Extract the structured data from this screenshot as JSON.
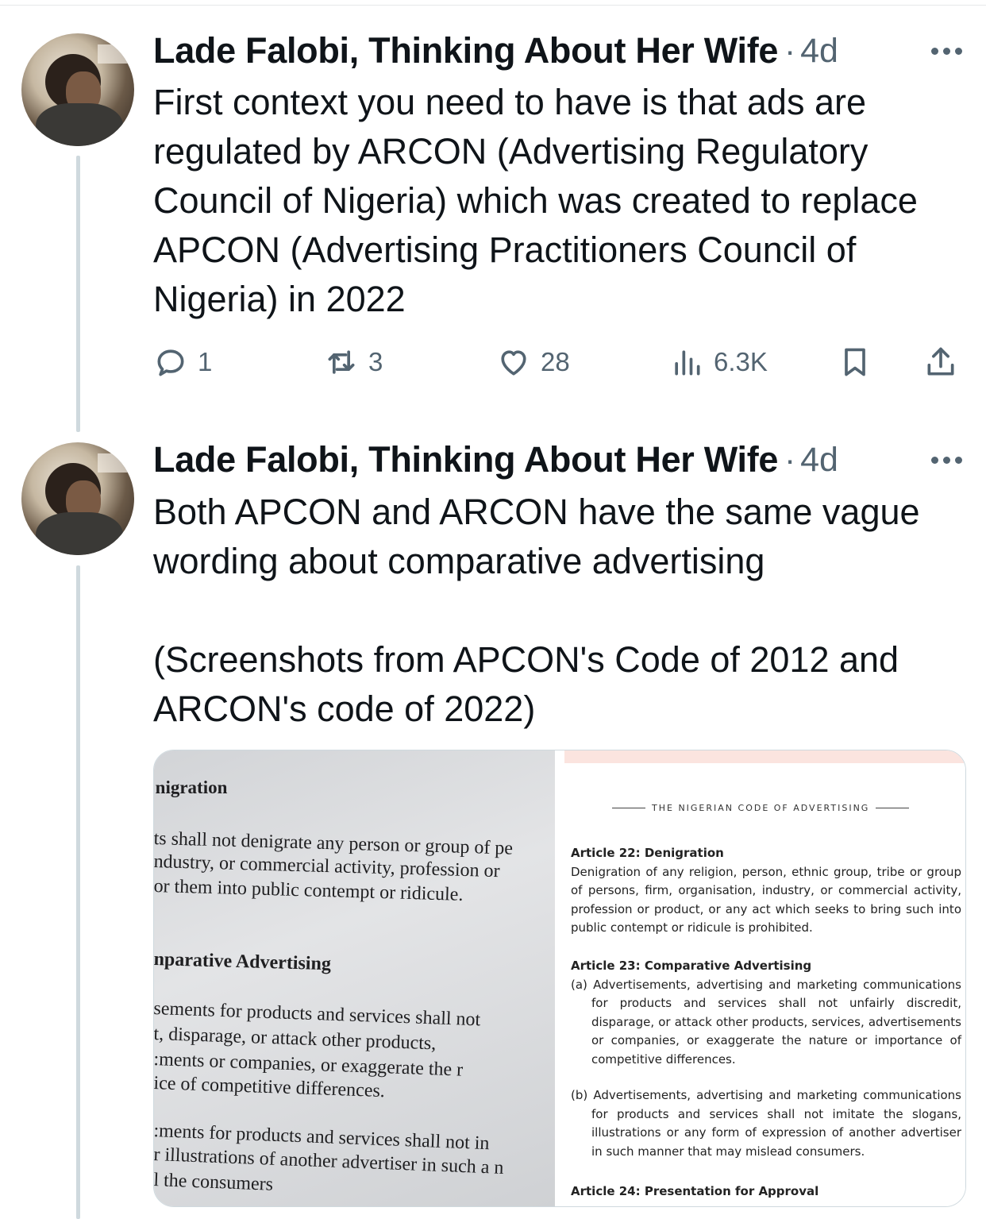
{
  "tweets": [
    {
      "author": "Lade Falobi, Thinking About Her Wife",
      "separator": "·",
      "time": "4d",
      "text": "First context you need to have is that ads are regulated by ARCON (Advertising Regulatory Council of Nigeria) which was created to replace APCON (Advertising Practitioners Council of Nigeria) in 2022",
      "replies": "1",
      "retweets": "3",
      "likes": "28",
      "views": "6.3K"
    },
    {
      "author": "Lade Falobi, Thinking About Her Wife",
      "separator": "·",
      "time": "4d",
      "text": "Both APCON and ARCON have the same vague wording about comparative advertising\n\n(Screenshots from APCON's Code of 2012 and ARCON's code of 2022)",
      "media": {
        "left_photo_lines": [
          ":nigration",
          "ts shall not denigrate any person or group of pe",
          "ndustry, or commercial activity, profession or",
          "or them into public contempt or ridicule.",
          "nparative Advertising",
          "sements for products and services shall not",
          "t, disparage, or attack other products,",
          ":ments or companies, or exaggerate the r",
          "ice of competitive differences.",
          ":ments for products and services shall not in",
          "r illustrations of another advertiser in such a n",
          "l the consumers"
        ],
        "right_doc": {
          "header": "THE NIGERIAN CODE OF ADVERTISING",
          "article22_title": "Article 22: Denigration",
          "article22_text": "Denigration of any religion, person, ethnic group, tribe or group of persons, firm, organisation, industry, or commercial activity, profession or product, or any act which seeks to bring such into public contempt or ridicule is prohibited.",
          "article23_title": "Article 23: Comparative Advertising",
          "article23_a": "(a) Advertisements, advertising and marketing communications for products and services shall not unfairly discredit, disparage, or attack other products, services, advertisements or companies, or exaggerate the nature or importance of competitive differences.",
          "article23_b": "(b) Advertisements, advertising and marketing communications for products and services shall not imitate the slogans, illustrations or any form of expression of another advertiser in such manner that may mislead consumers.",
          "article24_title": "Article 24: Presentation for Approval"
        }
      }
    }
  ]
}
